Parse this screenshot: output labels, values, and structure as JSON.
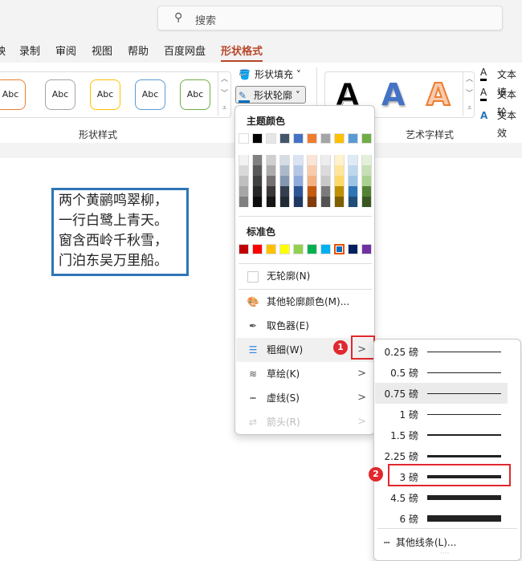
{
  "search": {
    "placeholder": "搜索",
    "icon": "search-icon"
  },
  "tabs": [
    "映",
    "录制",
    "审阅",
    "视图",
    "帮助",
    "百度网盘",
    "形状格式"
  ],
  "ribbon": {
    "shape_styles": {
      "label": "形状样式",
      "items": [
        "Abc",
        "Abc",
        "Abc",
        "Abc",
        "Abc"
      ],
      "colors": [
        "#ed7d31",
        "#a5a5a5",
        "#ffc000",
        "#5b9bd5",
        "#70ad47"
      ]
    },
    "fill_label": "形状填充",
    "outline_label": "形状轮廓",
    "wordart": {
      "label": "艺术字样式",
      "glyph": "A"
    },
    "text_fill": "文本填",
    "text_outline": "文本轮",
    "text_effects": "文本效"
  },
  "textbox": {
    "lines": [
      "两个黄鹂鸣翠柳，",
      "一行白鹭上青天。",
      "窗含西岭千秋雪，",
      "门泊东吴万里船。"
    ]
  },
  "menu": {
    "theme_header": "主题颜色",
    "theme_colors": [
      "#ffffff",
      "#000000",
      "#e7e6e6",
      "#44546a",
      "#4472c4",
      "#ed7d31",
      "#a5a5a5",
      "#ffc000",
      "#5b9bd5",
      "#70ad47"
    ],
    "shades": [
      [
        "#f2f2f2",
        "#d9d9d9",
        "#bfbfbf",
        "#a6a6a6",
        "#808080"
      ],
      [
        "#808080",
        "#595959",
        "#404040",
        "#262626",
        "#0d0d0d"
      ],
      [
        "#d0cece",
        "#aeabab",
        "#757171",
        "#3a3838",
        "#161616"
      ],
      [
        "#d6dce4",
        "#adb9ca",
        "#8497b0",
        "#333f4f",
        "#222a35"
      ],
      [
        "#dae3f3",
        "#b4c7e7",
        "#8faadc",
        "#2f5597",
        "#1f3864"
      ],
      [
        "#fbe5d6",
        "#f8cbad",
        "#f4b183",
        "#c55a11",
        "#843c0c"
      ],
      [
        "#ededed",
        "#dbdbdb",
        "#c9c9c9",
        "#7b7b7b",
        "#525252"
      ],
      [
        "#fff2cc",
        "#ffe699",
        "#ffd966",
        "#bf9000",
        "#7f6000"
      ],
      [
        "#deebf7",
        "#bdd7ee",
        "#9dc3e6",
        "#2e75b6",
        "#1f4e79"
      ],
      [
        "#e2f0d9",
        "#c5e0b4",
        "#a9d18e",
        "#548235",
        "#385723"
      ]
    ],
    "standard_header": "标准色",
    "standard_colors": [
      "#c00000",
      "#ff0000",
      "#ffc000",
      "#ffff00",
      "#92d050",
      "#00b050",
      "#00b0f0",
      "#0070c0",
      "#002060",
      "#7030a0"
    ],
    "selected_standard": 7,
    "items": [
      {
        "label": "无轮廓(N)",
        "icon": "no-outline-icon"
      },
      {
        "label": "其他轮廓颜色(M)...",
        "icon": "palette-icon"
      },
      {
        "label": "取色器(E)",
        "icon": "eyedropper-icon"
      },
      {
        "label": "粗细(W)",
        "icon": "weight-icon",
        "submenu": true
      },
      {
        "label": "草绘(K)",
        "icon": "sketch-icon",
        "submenu": true
      },
      {
        "label": "虚线(S)",
        "icon": "dash-icon",
        "submenu": true
      },
      {
        "label": "箭头(R)",
        "icon": "arrow-icon",
        "submenu": true,
        "disabled": true
      }
    ]
  },
  "weights": {
    "items": [
      "0.25 磅",
      "0.5 磅",
      "0.75 磅",
      "1 磅",
      "1.5 磅",
      "2.25 磅",
      "3 磅",
      "4.5 磅",
      "6 磅"
    ],
    "values_pt": [
      0.25,
      0.5,
      0.75,
      1,
      1.5,
      2.25,
      3,
      4.5,
      6
    ],
    "hovered": 2,
    "highlighted": 6,
    "more": "其他线条(L)..."
  },
  "badges": [
    "1",
    "2"
  ]
}
